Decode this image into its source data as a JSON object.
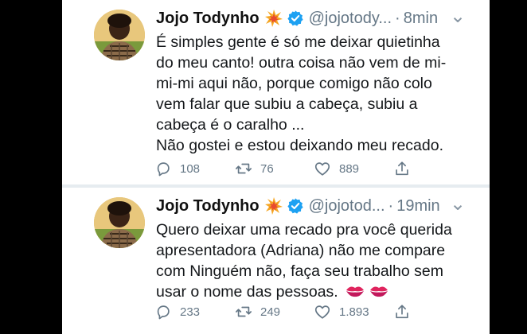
{
  "tweets": [
    {
      "display_name": "Jojo Todynho",
      "handle": "@jojotody...",
      "separator": "·",
      "time": "8min",
      "text": "É simples gente é só me deixar quietinha\ndo meu canto! outra coisa não vem de mi-\nmi-mi aqui não, porque comigo não colo\nvem falar que subiu a cabeça, subiu a\ncabeça é o caralho ...\nNão gostei e estou deixando meu recado.",
      "replies": "108",
      "retweets": "76",
      "likes": "889",
      "more_label": "⌄"
    },
    {
      "display_name": "Jojo Todynho",
      "handle": "@jojotod...",
      "separator": "·",
      "time": "19min",
      "text": "Quero deixar uma recado pra você querida\napresentadora (Adriana) não  me compare\ncom Ninguém não, faça  seu trabalho sem\nusar o nome das pessoas.",
      "replies": "233",
      "retweets": "249",
      "likes": "1.893",
      "more_label": "⌄"
    }
  ],
  "icons": {
    "reply": "reply-icon",
    "retweet": "retweet-icon",
    "like": "heart-icon",
    "share": "share-icon",
    "verified": "verified-badge-icon",
    "emoji_name": "collision-emoji-icon",
    "emoji_text": "kiss-mark-emoji-icon"
  },
  "colors": {
    "verified": "#1da1f2",
    "muted": "#657786",
    "text": "#14171a"
  }
}
